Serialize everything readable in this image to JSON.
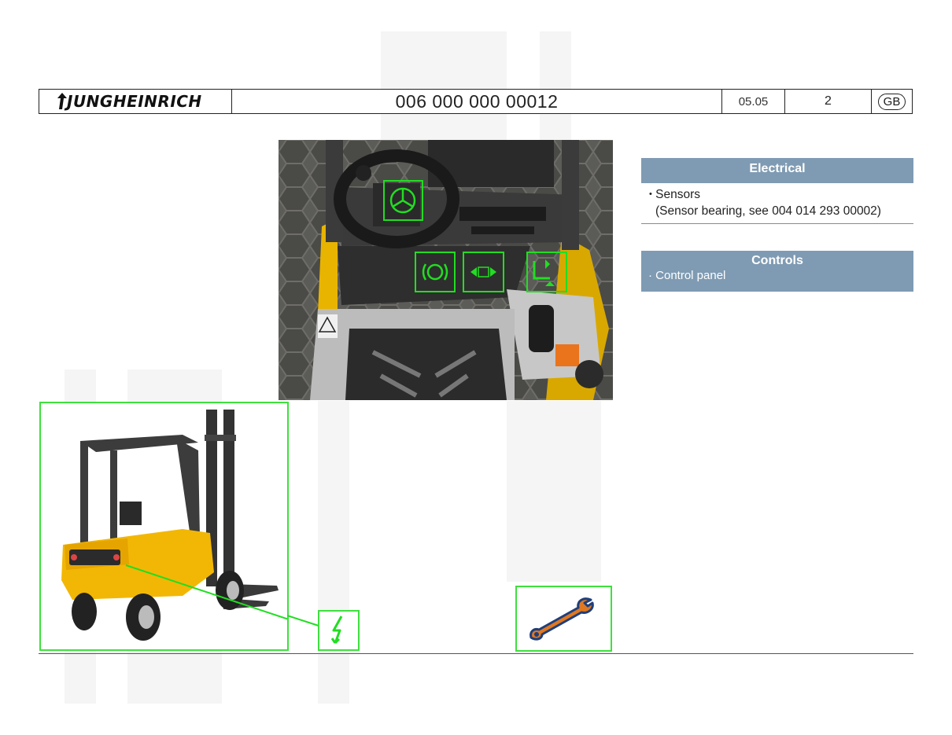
{
  "header": {
    "logo_text": "JUNGHEINRICH",
    "doc_number": "006 000 000 00012",
    "date": "05.05",
    "page": "2",
    "language": "GB"
  },
  "electrical_panel": {
    "title": "Electrical",
    "bullet": "•",
    "item_label": "Sensors",
    "item_detail": "(Sensor bearing, see 004 014 293 00002)"
  },
  "controls_panel": {
    "title": "Controls",
    "item": "· Control panel"
  },
  "icons": {
    "photo_highlights": [
      "steering-wheel-icon",
      "brake-icon",
      "steering-direction-icon",
      "hydraulic-lever-icon"
    ],
    "electrical": "lightning-icon",
    "tool": "wrench-icon"
  },
  "colors": {
    "highlight_green": "#22dd22",
    "panel_blue": "#7f9bb3",
    "forklift_yellow": "#f2b705"
  }
}
